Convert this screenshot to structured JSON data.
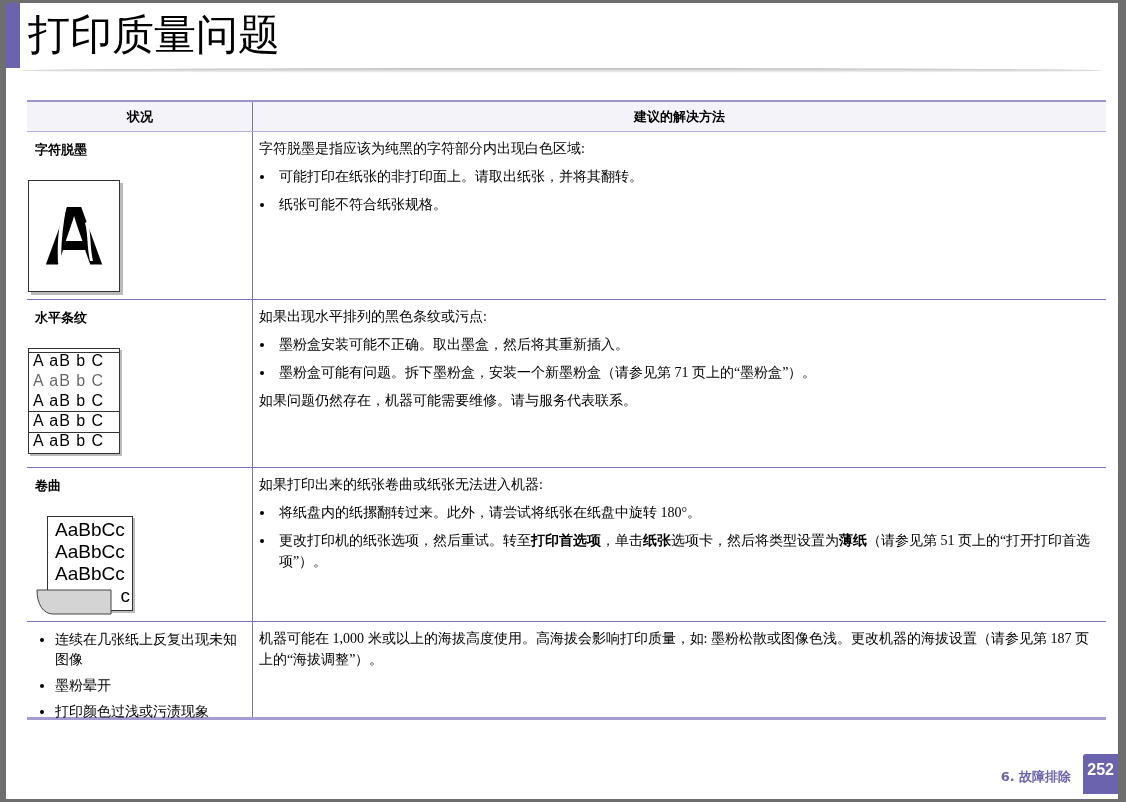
{
  "title": "打印质量问题",
  "table": {
    "columns": [
      "状况",
      "建议的解决方法"
    ],
    "rows": [
      {
        "condition": {
          "kind": "label",
          "text": "字符脱墨"
        },
        "illustration": {
          "kind": "faded",
          "lines": [
            "A"
          ]
        },
        "solution": [
          {
            "kind": "paragraph",
            "text": "字符脱墨是指应该为纯黑的字符部分内出现白色区域:"
          },
          {
            "kind": "bullet",
            "text": "可能打印在纸张的非打印面上。请取出纸张，并将其翻转。"
          },
          {
            "kind": "bullet",
            "text": "纸张可能不符合纸张规格。"
          }
        ]
      },
      {
        "condition": {
          "kind": "label",
          "text": "水平条纹"
        },
        "illustration": {
          "kind": "striped",
          "lines": [
            "A aB b C",
            "A aB b C",
            "A aB b C",
            "A aB b C",
            "A aB b C"
          ]
        },
        "solution": [
          {
            "kind": "paragraph",
            "text": "如果出现水平排列的黑色条纹或污点:"
          },
          {
            "kind": "bullet",
            "text": "墨粉盒安装可能不正确。取出墨盒，然后将其重新插入。"
          },
          {
            "kind": "bullet",
            "text": "墨粉盒可能有问题。拆下墨粉盒，安装一个新墨粉盒（请参见第 71 页上的“墨粉盒”）。"
          },
          {
            "kind": "paragraph",
            "text": "如果问题仍然存在，机器可能需要维修。请与服务代表联系。"
          }
        ]
      },
      {
        "condition": {
          "kind": "label",
          "text": "卷曲"
        },
        "illustration": {
          "kind": "curled",
          "lines": [
            "AaBbCc",
            "AaBbCc",
            "AaBbCc",
            "c"
          ]
        },
        "solution": [
          {
            "kind": "paragraph",
            "text": "如果打印出来的纸张卷曲或纸张无法进入机器:"
          },
          {
            "kind": "bullet",
            "text": "将纸盘内的纸摞翻转过来。此外，请尝试将纸张在纸盘中旋转 180°。"
          },
          {
            "kind": "bullet",
            "text": "更改打印机的纸张选项，然后重试。转至**打印首选项**，单击**纸张**选项卡，然后将类型设置为**薄纸**（请参见第 51 页上的“打开打印首选项”）。"
          }
        ]
      },
      {
        "condition": {
          "kind": "bullets",
          "items": [
            "连续在几张纸上反复出现未知图像",
            "墨粉晕开",
            "打印颜色过浅或污渍现象"
          ]
        },
        "solution": [
          {
            "kind": "paragraph",
            "text": "机器可能在 1,000 米或以上的海拔高度使用。高海拔会影响打印质量，如: 墨粉松散或图像色浅。更改机器的海拔设置（请参见第 187 页上的“海拔调整”）。"
          }
        ]
      }
    ]
  },
  "footer": {
    "chapter": "6.  故障排除",
    "page": "252"
  }
}
